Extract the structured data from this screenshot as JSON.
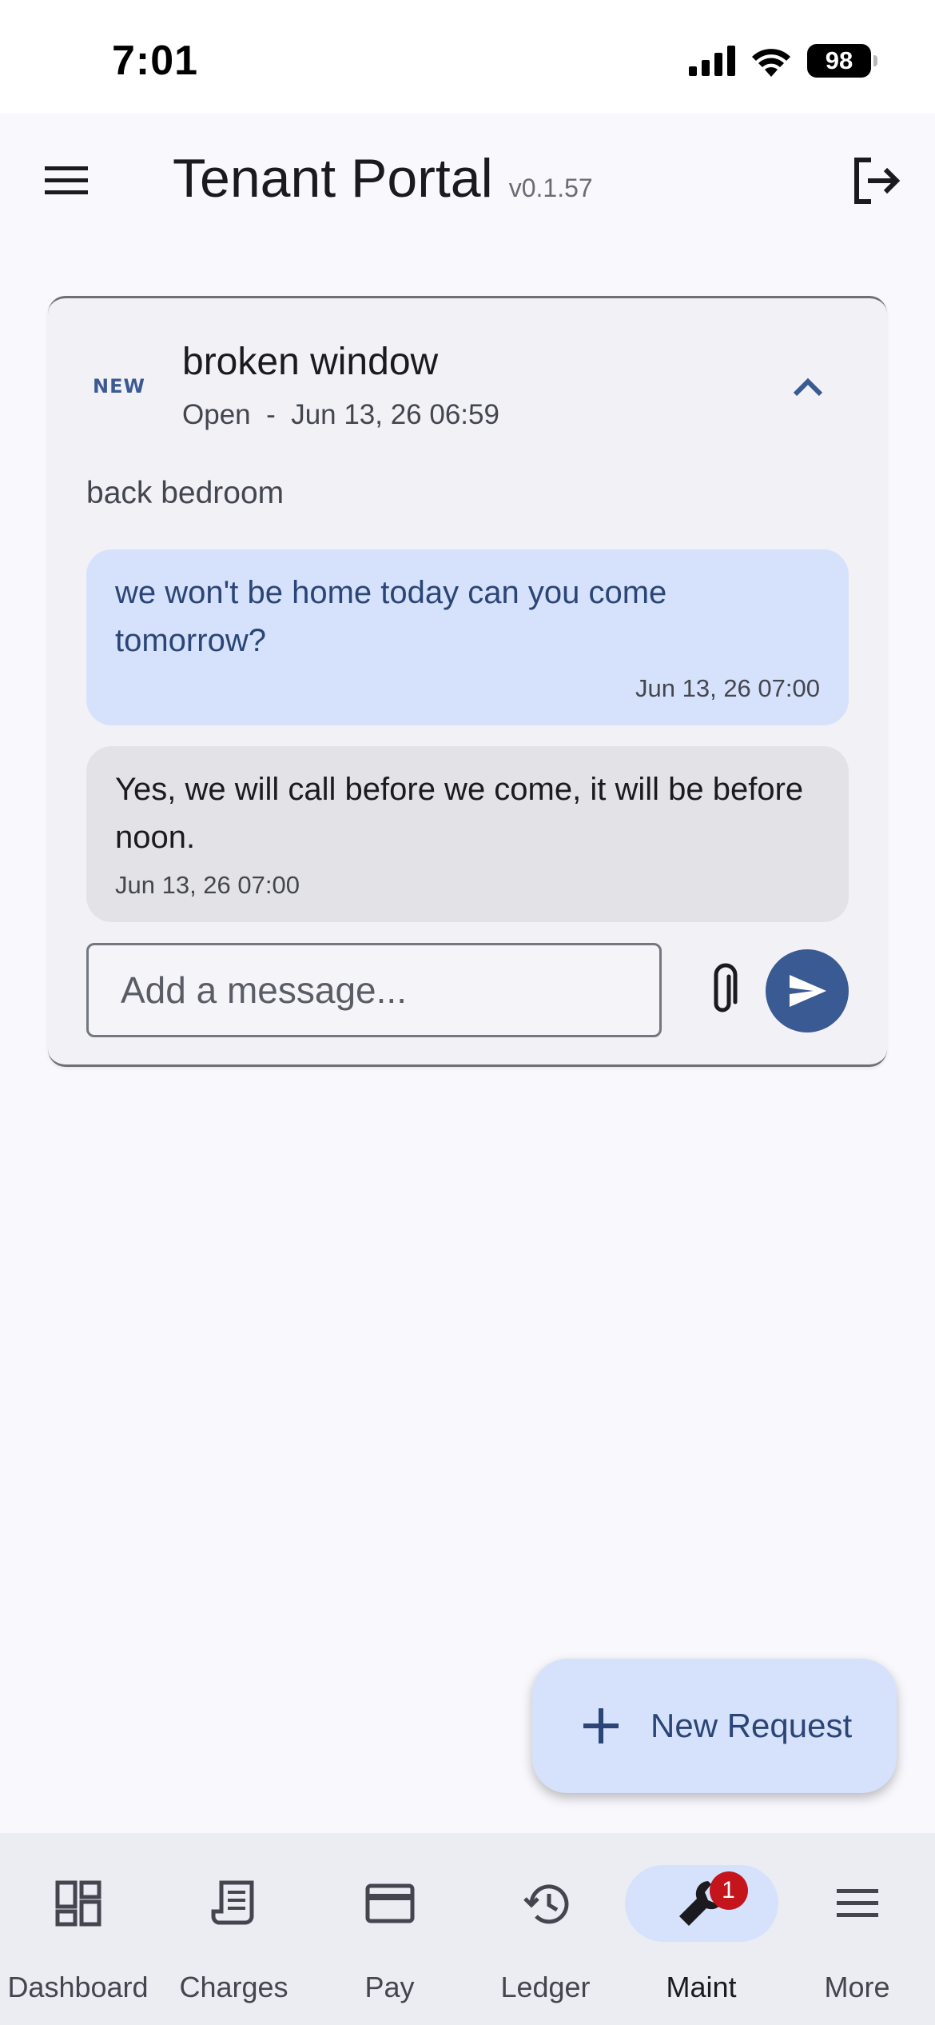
{
  "status_bar": {
    "time": "7:01",
    "battery": "98"
  },
  "app_bar": {
    "title": "Tenant Portal",
    "version": "v0.1.57"
  },
  "request": {
    "badge": "NEW",
    "title": "broken window",
    "status": "Open",
    "separator": "-",
    "created": "Jun 13, 26 06:59",
    "description": "back bedroom",
    "messages": [
      {
        "author": "tenant",
        "text": "we won't be home today can you come tomorrow?",
        "timestamp": "Jun 13, 26 07:00"
      },
      {
        "author": "manager",
        "text": "Yes, we will call before we come, it will be before noon.",
        "timestamp": "Jun 13, 26 07:00"
      }
    ],
    "input_placeholder": "Add a message..."
  },
  "fab": {
    "label": "New Request"
  },
  "bottom_nav": {
    "items": [
      {
        "label": "Dashboard",
        "icon": "dashboard-icon"
      },
      {
        "label": "Charges",
        "icon": "receipt-icon"
      },
      {
        "label": "Pay",
        "icon": "credit-card-icon"
      },
      {
        "label": "Ledger",
        "icon": "history-icon"
      },
      {
        "label": "Maint",
        "icon": "wrench-icon",
        "badge": "1",
        "active": true
      },
      {
        "label": "More",
        "icon": "menu-icon"
      }
    ]
  },
  "colors": {
    "accent": "#3a5a93",
    "accent_container": "#d6e2fb",
    "badge_red": "#c4141c",
    "background": "#f8f8fd"
  }
}
